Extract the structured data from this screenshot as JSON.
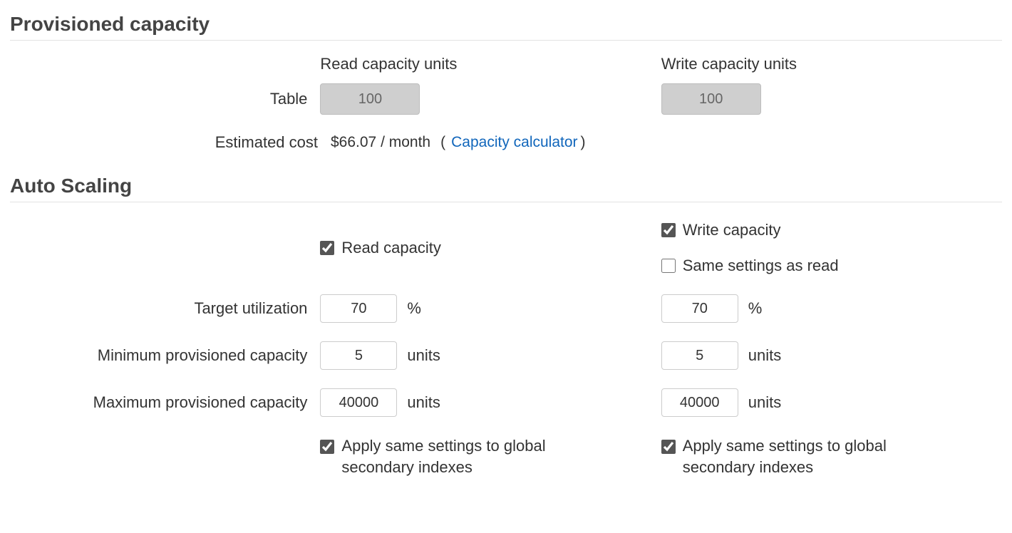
{
  "sections": {
    "provisioned": {
      "title": "Provisioned capacity",
      "columns": {
        "read": "Read capacity units",
        "write": "Write capacity units"
      },
      "rows": {
        "table_label": "Table",
        "table_read_value": "100",
        "table_write_value": "100",
        "estimated_cost_label": "Estimated cost",
        "estimated_cost_value": "$66.07 / month",
        "calculator_link": "Capacity calculator",
        "paren_open": "(",
        "paren_close": ")"
      }
    },
    "autoscaling": {
      "title": "Auto Scaling",
      "read_checkbox_label": "Read capacity",
      "write_checkbox_label": "Write capacity",
      "same_as_read_label": "Same settings as read",
      "rows": {
        "target_util_label": "Target utilization",
        "target_util_read": "70",
        "target_util_write": "70",
        "target_util_suffix": "%",
        "min_label": "Minimum provisioned capacity",
        "min_read": "5",
        "min_write": "5",
        "min_suffix": "units",
        "max_label": "Maximum provisioned capacity",
        "max_read": "40000",
        "max_write": "40000",
        "max_suffix": "units",
        "apply_gsi_label": "Apply same settings to global secondary indexes"
      }
    }
  }
}
